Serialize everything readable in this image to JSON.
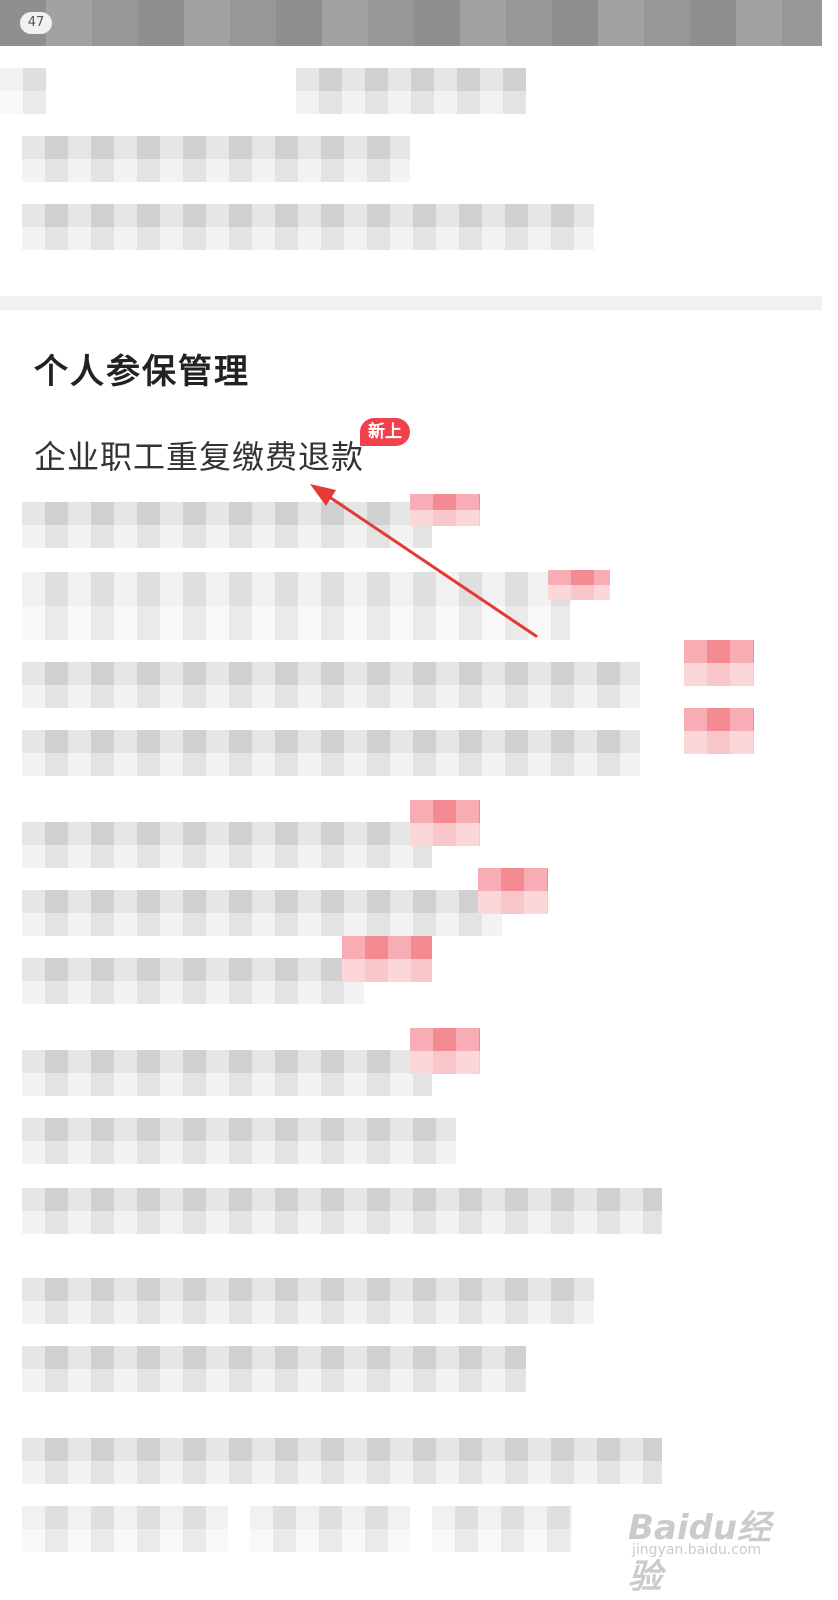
{
  "status_bar": {
    "notification_count": "47"
  },
  "section": {
    "title": "个人参保管理",
    "items": [
      {
        "label": "企业职工重复缴费退款",
        "badge": "新上"
      }
    ],
    "hidden_badge": "新上"
  },
  "annotation": {
    "color": "#e53935"
  },
  "watermark": {
    "logo": "Baidu经验",
    "url": "jingyan.baidu.com"
  },
  "colors": {
    "badge": "#f0414d",
    "divider": "#f2f2f2",
    "status_bar": "#9a9a9a"
  }
}
